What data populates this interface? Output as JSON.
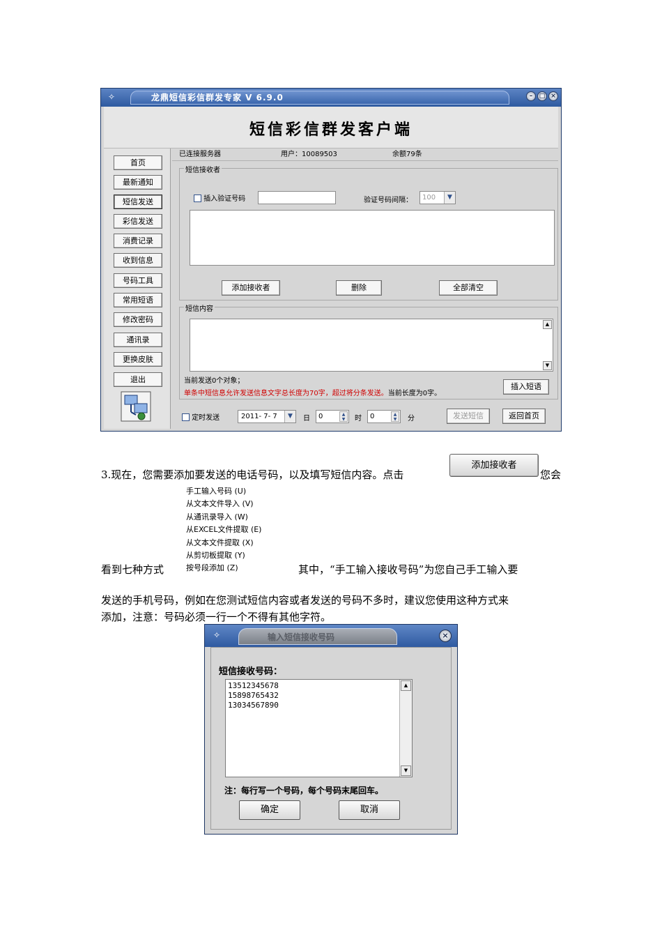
{
  "app": {
    "title": "龙鼎短信彩信群发专家 V 6.9.0",
    "window_buttons": [
      "minimize",
      "maximize",
      "close"
    ],
    "banner": "短信彩信群发客户端"
  },
  "sidebar": {
    "items": [
      "首页",
      "最新通知",
      "短信发送",
      "彩信发送",
      "消费记录",
      "收到信息",
      "号码工具",
      "常用短语",
      "修改密码",
      "通讯录",
      "更换皮肤",
      "退出"
    ],
    "active": "短信发送"
  },
  "status": {
    "connected": "已连接服务器",
    "user": "用户：10089503",
    "balance": "余额79条"
  },
  "receivers": {
    "group_label": "短信接收者",
    "insert_code_label": "插入验证号码",
    "interval_label": "验证号码间隔：",
    "interval_value": "100",
    "add_button": "添加接收者",
    "delete_button": "删除",
    "clear_button": "全部清空"
  },
  "content": {
    "group_label": "短信内容",
    "current_count": "当前发送0个对象；",
    "warning_red": "单条中短信息允许发送信息文字总长度为70字，超过将分条发送。",
    "current_length": "当前长度为0字。",
    "insert_phrase_button": "插入短语"
  },
  "schedule": {
    "timed_label": "定时发送",
    "date_value": "2011- 7- 7",
    "day_label": "日",
    "hour_value": "0",
    "hour_label": "时",
    "minute_value": "0",
    "minute_label": "分",
    "send_button": "发送短信",
    "back_button": "返回首页"
  },
  "doc": {
    "para1_a": "3.现在，您需要添加要发送的电话号码，以及填写短信内容。点击",
    "inline_button": "添加接收者",
    "para1_b": "您会",
    "para2_a": "看到七种方式",
    "para2_b": "其中，“手工输入接收号码”为您自己手工输入要",
    "para3": "发送的手机号码，例如在您测试短信内容或者发送的号码不多时，建议您使用这种方式来",
    "para4": "添加，注意：号码必须一行一个不得有其他字符。"
  },
  "menu": {
    "items": [
      "手工输入号码 (U)",
      "从文本文件导入 (V)",
      "从通讯录导入 (W)",
      "从EXCEL文件提取 (E)",
      "从文本文件提取 (X)",
      "从剪切板提取 (Y)",
      "按号段添加 (Z)"
    ]
  },
  "dialog": {
    "title": "输入短信接收号码",
    "label": "短信接收号码：",
    "numbers": [
      "13512345678",
      "15898765432",
      "13034567890"
    ],
    "note": "注：每行写一个号码，每个号码末尾回车。",
    "ok": "确定",
    "cancel": "取消"
  }
}
